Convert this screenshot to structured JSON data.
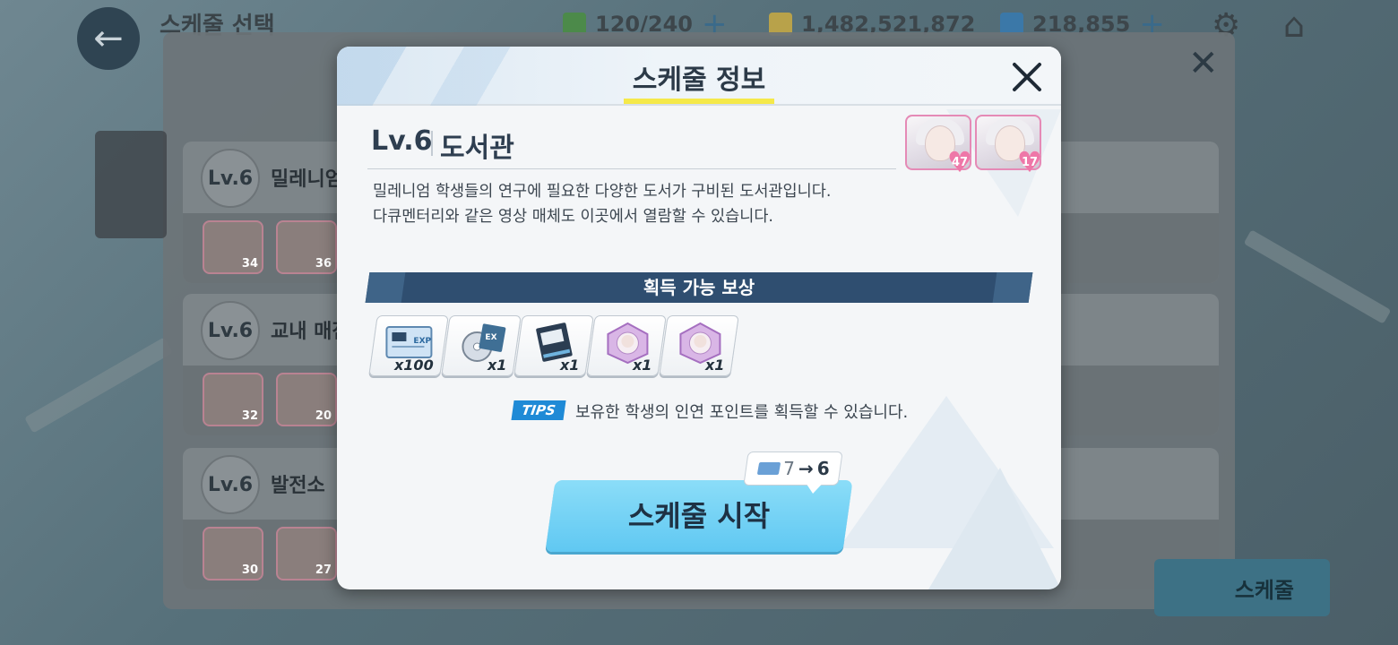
{
  "background": {
    "top_title": "스케줄 선택",
    "resources": [
      {
        "icon": "ap-icon",
        "value": "120/240"
      },
      {
        "icon": "credit-icon",
        "value": "1,482,521,872"
      },
      {
        "icon": "pyroxene-icon",
        "value": "218,855"
      }
    ],
    "cards": [
      {
        "level": "Lv.6",
        "name": "밀레니엄",
        "affinity": [
          "34",
          "36"
        ]
      },
      {
        "level": "Lv.6",
        "name": "교내 매점",
        "affinity": [
          "32",
          "20"
        ]
      },
      {
        "level": "Lv.6",
        "name": "발전소",
        "affinity": [
          "30",
          "27"
        ]
      }
    ],
    "schedule_button": "스케줄"
  },
  "modal": {
    "title": "스케줄 정보",
    "level": "Lv.6",
    "location": "도서관",
    "description": [
      "밀레니엄 학생들의 연구에 필요한 다양한 도서가 구비된 도서관입니다.",
      "다큐멘터리와 같은 영상 매체도 이곳에서 열람할 수 있습니다."
    ],
    "students": [
      {
        "icon": "student-portrait-icon",
        "affinity": "47"
      },
      {
        "icon": "student-portrait-icon",
        "affinity": "17"
      }
    ],
    "rewards_header": "획득 가능 보상",
    "rewards": [
      {
        "icon": "activity-report-icon",
        "qty": "x100"
      },
      {
        "icon": "ex-skill-disc-icon",
        "qty": "x1"
      },
      {
        "icon": "millennium-textbook-icon",
        "qty": "x1"
      },
      {
        "icon": "student-affinity-token-icon",
        "qty": "x1"
      },
      {
        "icon": "student-affinity-token-icon",
        "qty": "x1"
      }
    ],
    "tips_badge": "TIPS",
    "tips_text": "보유한 학생의 인연 포인트를 획득할 수 있습니다.",
    "cost": {
      "from": "7",
      "to": "6"
    },
    "start_button": "스케줄 시작"
  }
}
